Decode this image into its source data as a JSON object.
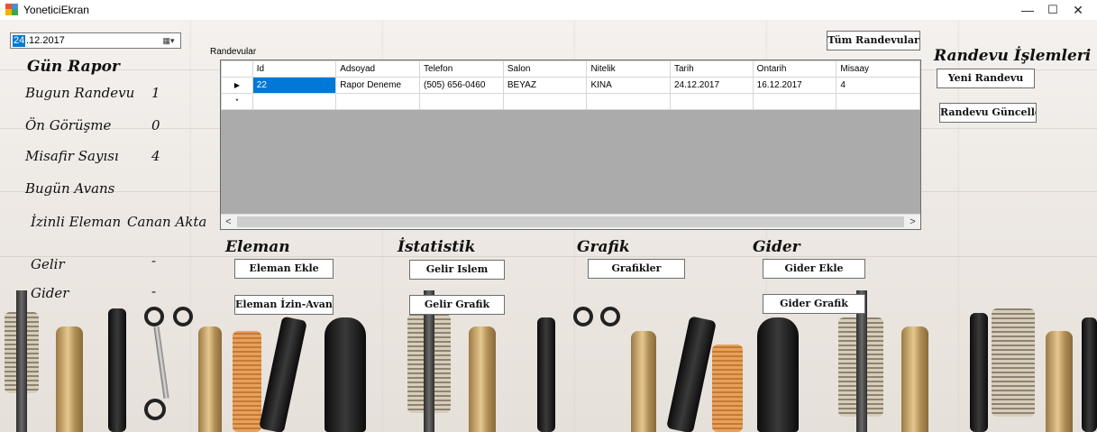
{
  "window": {
    "title": "YoneticiEkran",
    "minimize_glyph": "—",
    "maximize_glyph": "☐",
    "close_glyph": "✕"
  },
  "datepicker": {
    "selected_part": "24",
    "rest": ".12.2017",
    "icon": "calendar-dropdown-icon",
    "button_glyph": "▦▾"
  },
  "gun_rapor": {
    "title": "Gün Rapor",
    "rows": [
      {
        "label": "Bugun Randevu",
        "value": "1"
      },
      {
        "label": "Ön Görüşme",
        "value": "0"
      },
      {
        "label": "Misafir Sayısı",
        "value": "4"
      },
      {
        "label": "Bugün Avans",
        "value": ""
      },
      {
        "label": "İzinli Eleman",
        "value": "Canan Akta"
      },
      {
        "label": "Gelir",
        "value": "-"
      },
      {
        "label": "Gider",
        "value": "-"
      }
    ]
  },
  "randevular": {
    "caption": "Randevular",
    "all_button": "Tüm Randevular",
    "columns": [
      "Id",
      "Adsoyad",
      "Telefon",
      "Salon",
      "Nitelik",
      "Tarih",
      "Ontarih",
      "Misaay"
    ],
    "rows": [
      [
        "22",
        "Rapor Deneme",
        "(505) 656-0460",
        "BEYAZ",
        "KINA",
        "24.12.2017",
        "16.12.2017",
        "4"
      ]
    ],
    "current_row_marker": "▶",
    "new_row_marker": "*",
    "scroll_left": "<",
    "scroll_right": ">"
  },
  "randevu_islemleri": {
    "title": "Randevu İşlemleri",
    "new_button": "Yeni Randevu",
    "update_button": "Randevu Güncelle"
  },
  "eleman": {
    "title": "Eleman",
    "add_button": "Eleman Ekle",
    "leave_button": "Eleman İzin-Avans"
  },
  "istatistik": {
    "title": "İstatistik",
    "income_button": "Gelir Islem",
    "income_chart_button": "Gelir Grafik"
  },
  "grafik": {
    "title": "Grafik",
    "charts_button": "Grafikler"
  },
  "gider": {
    "title": "Gider",
    "add_button": "Gider Ekle",
    "chart_button": "Gider Grafik"
  },
  "colors": {
    "selection": "#0078d7",
    "grid_background": "#ababab",
    "wood_background": "#ece7e2"
  }
}
